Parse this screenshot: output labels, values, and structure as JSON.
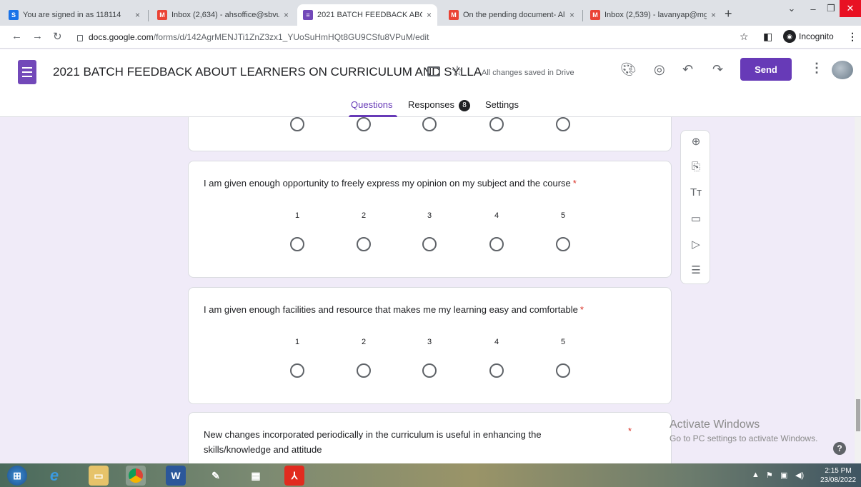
{
  "browser": {
    "tabs": [
      {
        "title": "You are signed in as 118114",
        "favicon": "S"
      },
      {
        "title": "Inbox (2,634) - ahsoffice@sbvu",
        "favicon": "M"
      },
      {
        "title": "2021 BATCH FEEDBACK ABOUT",
        "favicon": "≡"
      },
      {
        "title": "On the pending document- Al",
        "favicon": "M"
      },
      {
        "title": "Inbox (2,539) - lavanyap@mgr",
        "favicon": "M"
      }
    ],
    "close_glyph": "×",
    "new_tab": "+",
    "url_domain": "docs.google.com",
    "url_path": "/forms/d/142AgrMENJTi1ZnZ3zx1_YUoSuHmHQt8GU9CSfu8VPuM/edit",
    "incognito_label": "Incognito"
  },
  "header": {
    "doc_title": "2021 BATCH FEEDBACK ABOUT LEARNERS ON CURRICULUM AND SYLLA",
    "saved_status": "All changes saved in Drive",
    "send_label": "Send"
  },
  "form_tabs": {
    "questions": "Questions",
    "responses": "Responses",
    "responses_count": "8",
    "settings": "Settings"
  },
  "questions": [
    {
      "text": "I am given enough opportunity to freely express my opinion on my subject and the course",
      "required": "*",
      "scale": [
        "1",
        "2",
        "3",
        "4",
        "5"
      ]
    },
    {
      "text": "I am given enough facilities and resource that makes me my learning easy and comfortable",
      "required": "*",
      "scale": [
        "1",
        "2",
        "3",
        "4",
        "5"
      ]
    },
    {
      "text_line1": "New changes incorporated periodically in the curriculum is useful in enhancing the",
      "text_line2": "skills/knowledge and attitude",
      "required": "*"
    }
  ],
  "sidetools": {
    "add_question": "⊕",
    "import": "⎘",
    "title_text": "Tт",
    "image": "▭",
    "video": "▷",
    "section": "☰"
  },
  "watermark": {
    "line1": "Activate Windows",
    "line2": "Go to PC settings to activate Windows."
  },
  "taskbar": {
    "time": "2:15 PM",
    "date": "23/08/2022"
  }
}
